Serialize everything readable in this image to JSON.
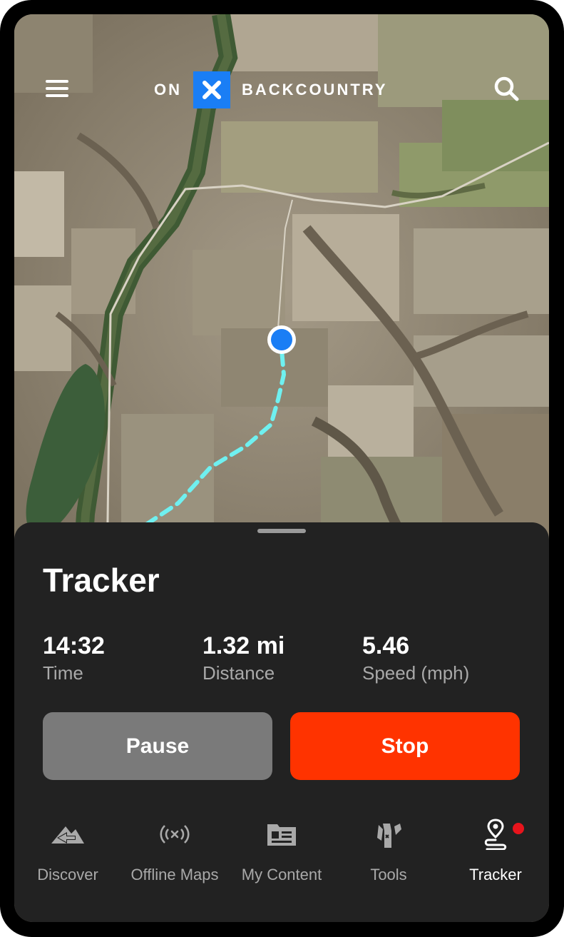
{
  "header": {
    "logo_left": "ON",
    "logo_right": "BACKCOUNTRY",
    "menu_icon": "hamburger-menu-icon",
    "search_icon": "search-icon"
  },
  "map": {
    "location_marker": "current-location-dot",
    "track_color": "#6ff0f0",
    "location_color": "#1a7ef5"
  },
  "tracker": {
    "title": "Tracker",
    "stats": [
      {
        "value": "14:32",
        "label": "Time"
      },
      {
        "value": "1.32 mi",
        "label": "Distance"
      },
      {
        "value": "5.46",
        "label": "Speed (mph)"
      }
    ],
    "pause_label": "Pause",
    "stop_label": "Stop"
  },
  "nav": {
    "items": [
      {
        "label": "Discover",
        "icon": "discover-icon"
      },
      {
        "label": "Offline Maps",
        "icon": "offline-maps-icon"
      },
      {
        "label": "My Content",
        "icon": "my-content-icon"
      },
      {
        "label": "Tools",
        "icon": "tools-icon"
      },
      {
        "label": "Tracker",
        "icon": "tracker-icon",
        "active": true,
        "has_notification": true
      }
    ]
  },
  "colors": {
    "accent_blue": "#1a7ef5",
    "stop_red": "#ff3300",
    "sheet_bg": "#222222",
    "notification_red": "#e8141c"
  }
}
